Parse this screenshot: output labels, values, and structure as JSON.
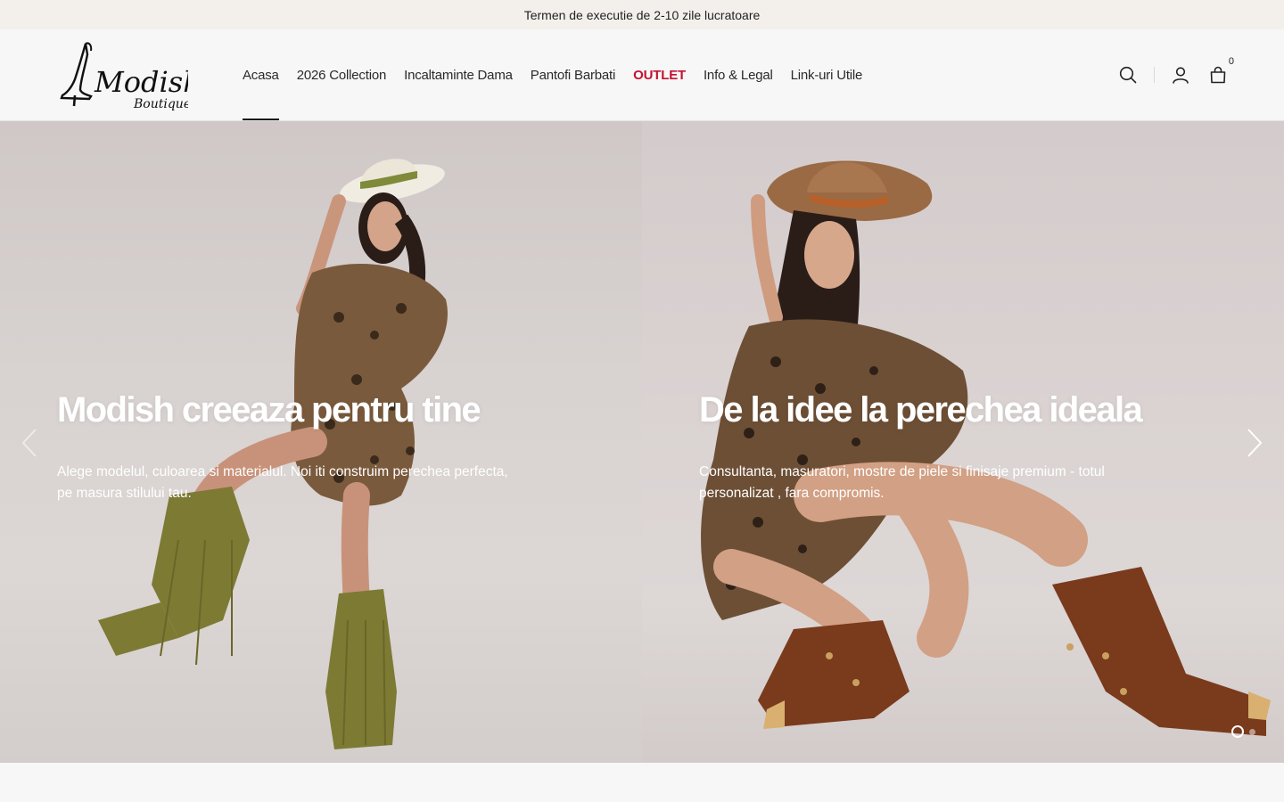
{
  "announcement": "Termen de executie de 2-10 zile lucratoare",
  "logo": {
    "main": "Modish",
    "sub": "Boutique"
  },
  "nav": [
    {
      "label": "Acasa"
    },
    {
      "label": "2026 Collection"
    },
    {
      "label": "Incaltaminte Dama"
    },
    {
      "label": "Pantofi Barbati"
    },
    {
      "label": "OUTLET"
    },
    {
      "label": "Info & Legal"
    },
    {
      "label": "Link-uri Utile"
    }
  ],
  "icons": {
    "search": "search-icon",
    "account": "user-icon",
    "cart": "bag-icon"
  },
  "cart_count": "0",
  "slides": [
    {
      "title": "Modish creeaza pentru tine",
      "subtitle": "Alege modelul, culoarea si materialul. Noi iti construim perechea perfecta, pe masura stilului tau."
    },
    {
      "title": "De la idee la perechea ideala",
      "subtitle": "Consultanta, masuratori, mostre de piele si finisaje premium - totul personalizat , fara compromis."
    }
  ],
  "colors": {
    "outlet": "#c41230",
    "announce_bg": "#f3f0ec"
  }
}
